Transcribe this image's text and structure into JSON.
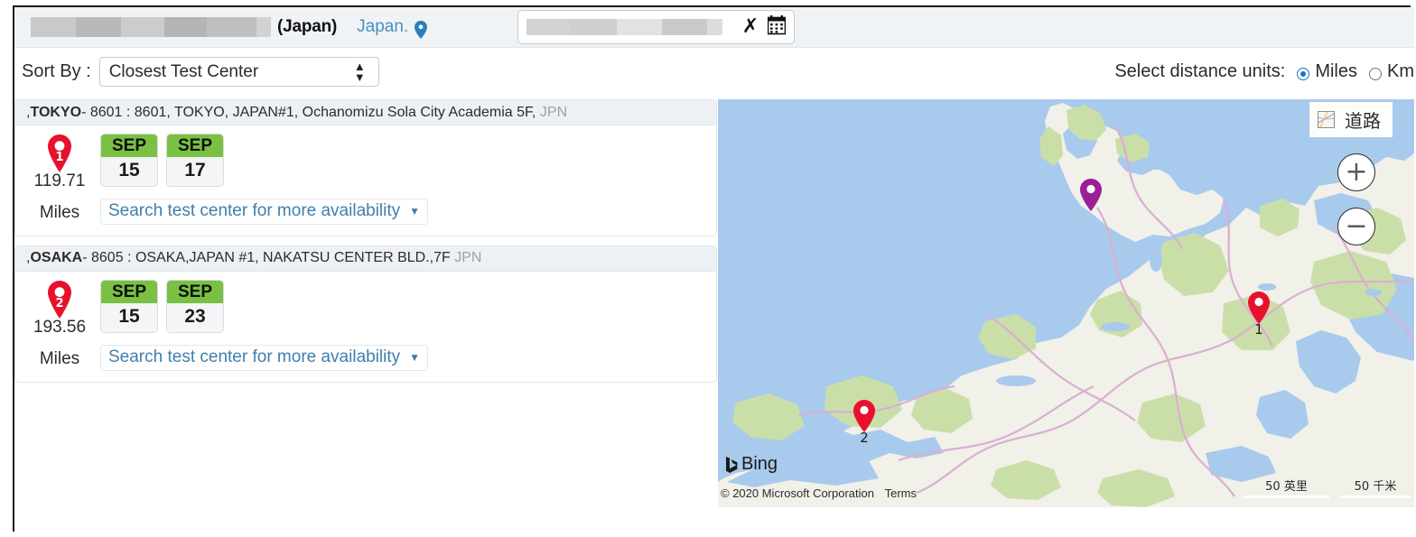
{
  "header": {
    "candidate_name_redacted": "",
    "country_paren": "(Japan)",
    "country_link": "Japan.",
    "location_icon": "location-pin-icon",
    "date_value_redacted": "",
    "clear_icon": "close-x-icon",
    "calendar_icon": "calendar-icon"
  },
  "toolbar": {
    "sort_label": "Sort By :",
    "sort_value": "Closest Test Center",
    "sort_options": [
      "Closest Test Center"
    ],
    "units_label": "Select distance units:",
    "unit_miles": "Miles",
    "unit_km": "Km",
    "unit_selected": "Miles"
  },
  "results": [
    {
      "prefix": ", ",
      "city": "TOKYO",
      "details": " - 8601 : 8601, TOKYO, JAPAN#1, Ochanomizu Sola City Academia 5F,",
      "country_code": "JPN",
      "pin_number": "1",
      "distance": "119.71",
      "distance_unit": "Miles",
      "dates": [
        {
          "month": "SEP",
          "day": "15"
        },
        {
          "month": "SEP",
          "day": "17"
        }
      ],
      "search_more": "Search test center for more availability"
    },
    {
      "prefix": ", ",
      "city": "OSAKA",
      "details": " - 8605 : OSAKA,JAPAN #1, NAKATSU CENTER BLD.,7F",
      "country_code": "JPN",
      "pin_number": "2",
      "distance": "193.56",
      "distance_unit": "Miles",
      "dates": [
        {
          "month": "SEP",
          "day": "15"
        },
        {
          "month": "SEP",
          "day": "23"
        }
      ],
      "search_more": "Search test center for more availability"
    }
  ],
  "map": {
    "map_type_label": "道路",
    "map_type_icon": "road-map-icon",
    "zoom_in": "+",
    "zoom_out": "−",
    "brand": "Bing",
    "copyright": "© 2020 Microsoft Corporation",
    "terms": "Terms",
    "scale_miles": "50 英里",
    "scale_km": "50 千米",
    "pins": [
      {
        "label": "1",
        "color": "#e8112d"
      },
      {
        "label": "2",
        "color": "#e8112d"
      },
      {
        "label": "",
        "color": "#9b1f97"
      }
    ],
    "colors": {
      "water": "#a8caec",
      "land": "#f1f0e9",
      "forest": "#cadfa8",
      "road": "#d9afd1",
      "pin_red": "#e8112d",
      "pin_purple": "#9b1f97"
    }
  }
}
